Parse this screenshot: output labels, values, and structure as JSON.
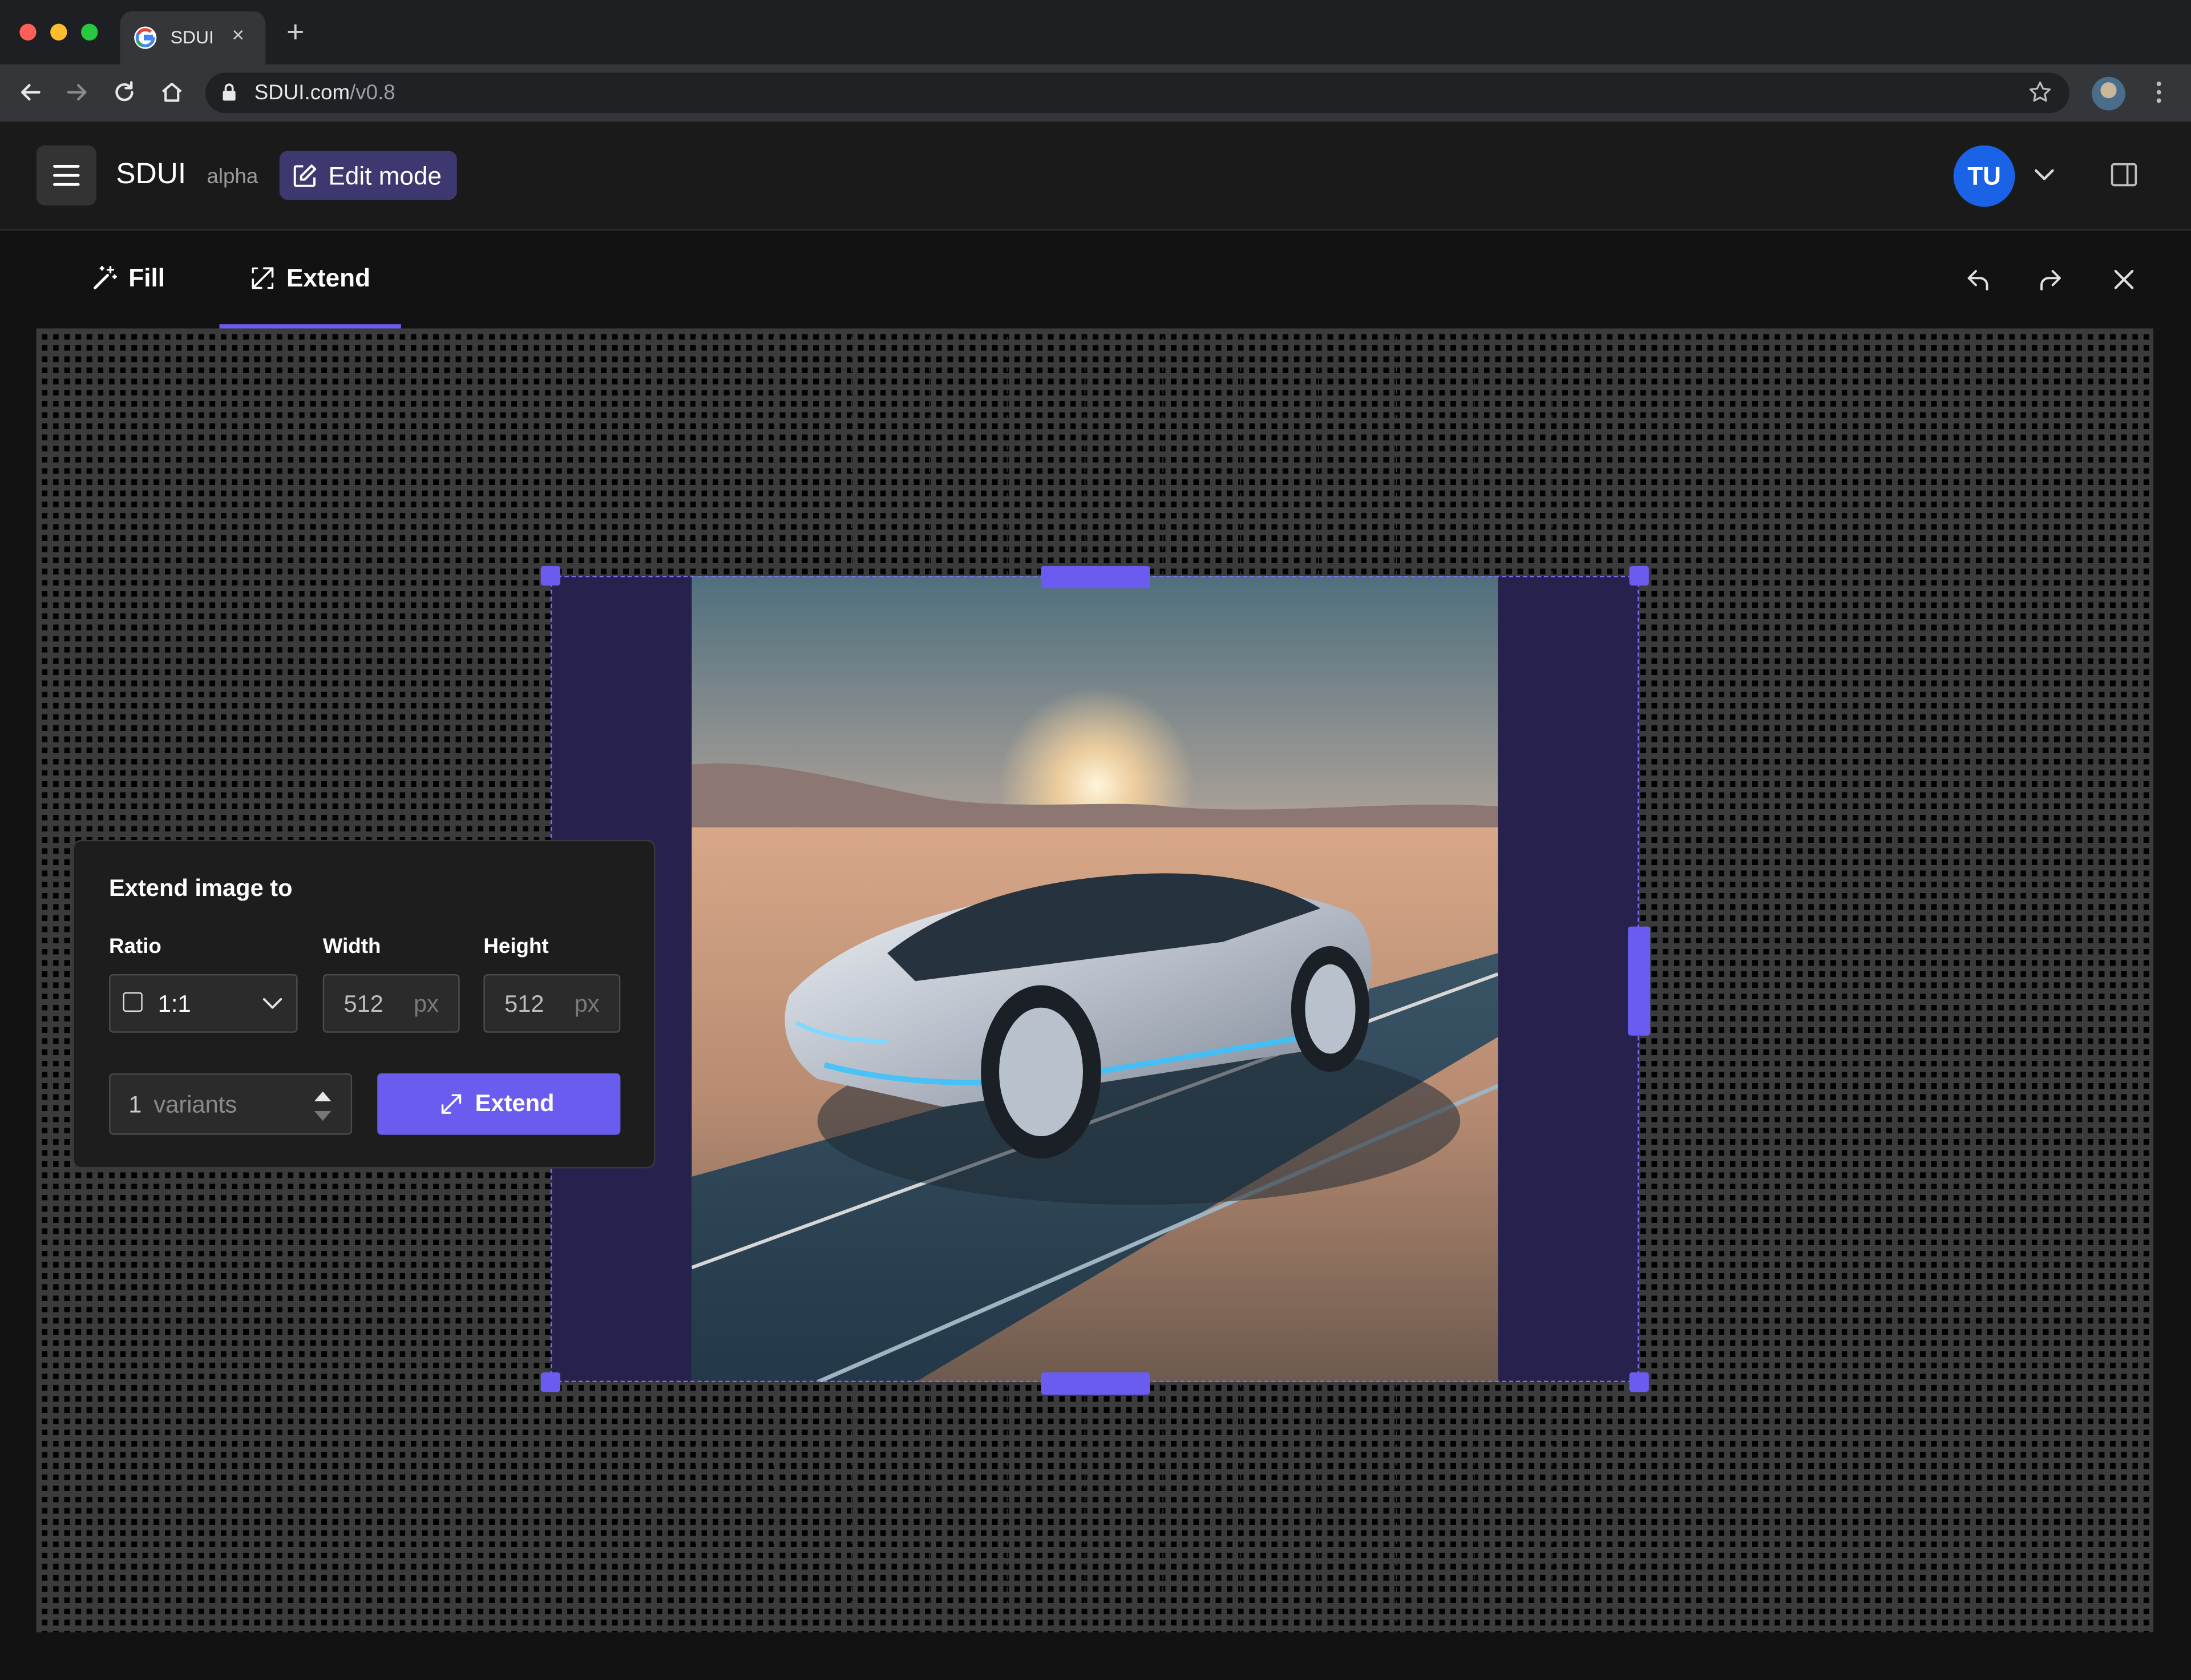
{
  "browser": {
    "tab_title": "SDUI",
    "url_host": "SDUI.com",
    "url_path": "/v0.8"
  },
  "header": {
    "brand": "SDUI",
    "badge": "alpha",
    "edit_mode_label": "Edit mode",
    "avatar_initials": "TU"
  },
  "tools": {
    "fill_label": "Fill",
    "extend_label": "Extend",
    "active": "Extend"
  },
  "panel": {
    "title": "Extend image to",
    "ratio_label": "Ratio",
    "ratio_value": "1:1",
    "width_label": "Width",
    "width_value": "512",
    "width_unit": "px",
    "height_label": "Height",
    "height_value": "512",
    "height_unit": "px",
    "variants_count": "1",
    "variants_label": "variants",
    "extend_button": "Extend"
  },
  "canvas": {
    "image_subject": "silver electric car on desert road at sunset",
    "accent_color": "#6b5cf0",
    "extend_zone_color": "#27224d"
  }
}
